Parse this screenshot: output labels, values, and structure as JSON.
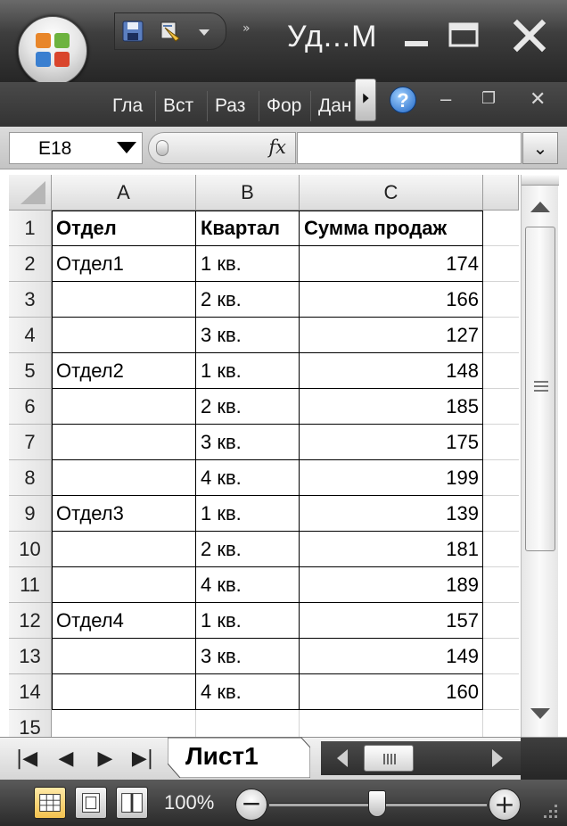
{
  "window": {
    "title": "Уд...М",
    "min_glyph": "—",
    "max_glyph": "❐",
    "close_glyph": "✕"
  },
  "quick_access": {
    "more_glyph": "»"
  },
  "ribbon": {
    "tabs": [
      "Гла",
      "Вст",
      "Раз",
      "Фор",
      "Дан"
    ],
    "help_glyph": "?",
    "min_glyph": "–",
    "restore_glyph": "❐",
    "close_glyph": "✕"
  },
  "formula_bar": {
    "name_box": "E18",
    "fx_label": "fx",
    "formula": "",
    "expand_glyph": "⌄"
  },
  "sheet": {
    "columns": [
      "A",
      "B",
      "C"
    ],
    "rows": [
      {
        "row": "1",
        "a": "Отдел",
        "b": "Квартал",
        "c": "Сумма продаж",
        "header": true
      },
      {
        "row": "2",
        "a": "Отдел1",
        "b": "1 кв.",
        "c": "174"
      },
      {
        "row": "3",
        "a": "",
        "b": "2 кв.",
        "c": "166"
      },
      {
        "row": "4",
        "a": "",
        "b": "3 кв.",
        "c": "127"
      },
      {
        "row": "5",
        "a": "Отдел2",
        "b": "1 кв.",
        "c": "148"
      },
      {
        "row": "6",
        "a": "",
        "b": "2 кв.",
        "c": "185"
      },
      {
        "row": "7",
        "a": "",
        "b": "3 кв.",
        "c": "175"
      },
      {
        "row": "8",
        "a": "",
        "b": "4 кв.",
        "c": "199"
      },
      {
        "row": "9",
        "a": "Отдел3",
        "b": "1 кв.",
        "c": "139"
      },
      {
        "row": "10",
        "a": "",
        "b": "2 кв.",
        "c": "181"
      },
      {
        "row": "11",
        "a": "",
        "b": "4 кв.",
        "c": "189"
      },
      {
        "row": "12",
        "a": "Отдел4",
        "b": "1 кв.",
        "c": "157"
      },
      {
        "row": "13",
        "a": "",
        "b": "3 кв.",
        "c": "149"
      },
      {
        "row": "14",
        "a": "",
        "b": "4 кв.",
        "c": "160"
      },
      {
        "row": "15",
        "a": "",
        "b": "",
        "c": ""
      }
    ]
  },
  "tabs_bar": {
    "nav": [
      "|◀",
      "◀",
      "▶",
      "▶|"
    ],
    "active_sheet": "Лист1"
  },
  "status": {
    "zoom_label": "100%",
    "zoom_out": "−",
    "zoom_in": "+",
    "zoom_level": 100
  },
  "colors": {
    "title_bar": "#2f2f2f",
    "grid_line": "#d4d4d4",
    "table_border": "#000000"
  }
}
